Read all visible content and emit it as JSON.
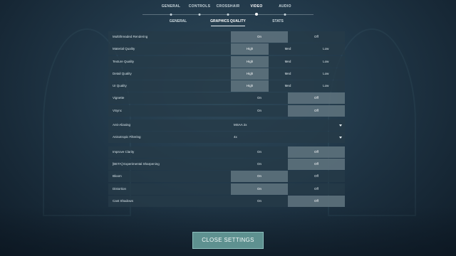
{
  "nav": {
    "top": [
      "GENERAL",
      "CONTROLS",
      "CROSSHAIR",
      "VIDEO",
      "AUDIO"
    ],
    "top_active": "VIDEO",
    "sub": [
      "GENERAL",
      "GRAPHICS QUALITY",
      "STATS"
    ],
    "sub_active": "GRAPHICS QUALITY"
  },
  "settings": [
    {
      "label": "Multithreaded Rendering",
      "type": "two",
      "options": [
        "On",
        "Off"
      ],
      "selected": "On"
    },
    {
      "label": "Material Quality",
      "type": "three",
      "options": [
        "High",
        "Med",
        "Low"
      ],
      "selected": "High"
    },
    {
      "label": "Texture Quality",
      "type": "three",
      "options": [
        "High",
        "Med",
        "Low"
      ],
      "selected": "High"
    },
    {
      "label": "Detail Quality",
      "type": "three",
      "options": [
        "High",
        "Med",
        "Low"
      ],
      "selected": "High"
    },
    {
      "label": "UI Quality",
      "type": "three",
      "options": [
        "High",
        "Med",
        "Low"
      ],
      "selected": "High"
    },
    {
      "label": "Vignette",
      "type": "two",
      "options": [
        "On",
        "Off"
      ],
      "selected": "Off"
    },
    {
      "label": "VSync",
      "type": "two",
      "options": [
        "On",
        "Off"
      ],
      "selected": "Off"
    },
    {
      "label": "Anti-Aliasing",
      "type": "dropdown",
      "value": "MSAA 2x"
    },
    {
      "label": "Anisotropic Filtering",
      "type": "dropdown",
      "value": "4x"
    },
    {
      "label": "Improve Clarity",
      "type": "two",
      "options": [
        "On",
        "Off"
      ],
      "selected": "Off"
    },
    {
      "label": "[BETA] Experimental Sharpening",
      "type": "two",
      "options": [
        "On",
        "Off"
      ],
      "selected": "Off"
    },
    {
      "label": "Bloom",
      "type": "two",
      "options": [
        "On",
        "Off"
      ],
      "selected": "On"
    },
    {
      "label": "Distortion",
      "type": "two",
      "options": [
        "On",
        "Off"
      ],
      "selected": "On"
    },
    {
      "label": "Cast Shadows",
      "type": "two",
      "options": [
        "On",
        "Off"
      ],
      "selected": "Off"
    }
  ],
  "close_button": "CLOSE SETTINGS",
  "colors": {
    "accent": "#5e9190",
    "row_bg": "#263a48",
    "selected_bg": "#82969e"
  },
  "icons": {
    "dropdown": "chevron-down-icon"
  }
}
